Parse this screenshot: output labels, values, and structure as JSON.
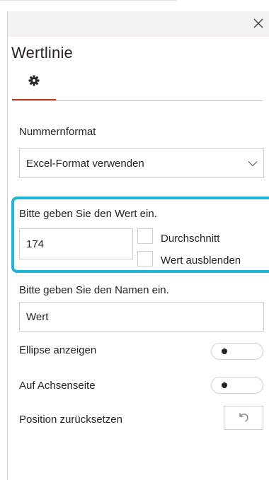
{
  "panel": {
    "title": "Wertlinie",
    "tab_icon": "gear-icon",
    "accent_color": "#c43e1c",
    "highlight_color": "#1fb7d9"
  },
  "number_format": {
    "label": "Nummernformat",
    "selected": "Excel-Format verwenden"
  },
  "value_section": {
    "label": "Bitte geben Sie den Wert ein.",
    "value": "174",
    "average_label": "Durchschnitt",
    "average_checked": false,
    "hide_value_label": "Wert ausblenden",
    "hide_value_checked": false
  },
  "name_section": {
    "label": "Bitte geben Sie den Namen ein.",
    "value": "Wert"
  },
  "ellipse": {
    "label": "Ellipse anzeigen",
    "on": false
  },
  "axis_side": {
    "label": "Auf Achsenseite",
    "on": false
  },
  "reset": {
    "label": "Position zurücksetzen",
    "icon": "undo-icon"
  }
}
